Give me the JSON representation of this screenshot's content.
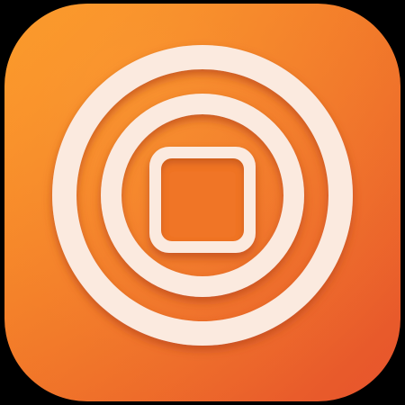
{
  "icon": {
    "name": "stop-record-app-icon",
    "symbol": "stop-in-ring-icon"
  },
  "colors": {
    "background": "#000000",
    "tile_gradient_top_left": "#FB9524",
    "tile_gradient_bottom_right": "#E6532C",
    "ring_fill": "#FBEADF",
    "ring_shadow": "#B9461C",
    "inner_square": "#F07428"
  }
}
